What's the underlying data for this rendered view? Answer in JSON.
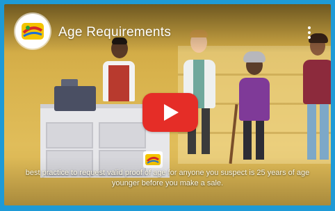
{
  "video": {
    "title": "Age Requirements",
    "caption_line_1": "best practice to request valid proof of age for anyone you suspect is 25 years of age",
    "caption_line_2": "younger before you make a sale.",
    "logo_icon": "channel-logo-icon",
    "more_icon": "more-vert-icon",
    "play_icon": "youtube-play-icon"
  },
  "colors": {
    "frame_border": "#1e9ad6",
    "play_button": "#e52d27",
    "background": "#d8b24c"
  }
}
